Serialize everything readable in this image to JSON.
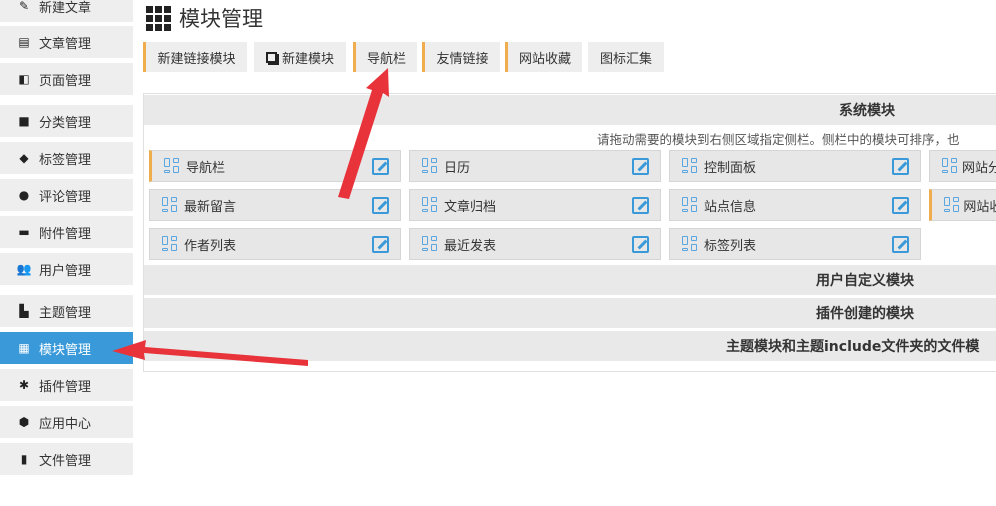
{
  "sidebar": {
    "items": [
      {
        "label": "新建文章",
        "icon": "edit-icon"
      },
      {
        "label": "文章管理",
        "icon": "document-icon"
      },
      {
        "label": "页面管理",
        "icon": "page-icon"
      },
      {
        "label": "分类管理",
        "icon": "folder-icon"
      },
      {
        "label": "标签管理",
        "icon": "tag-icon"
      },
      {
        "label": "评论管理",
        "icon": "comment-icon"
      },
      {
        "label": "附件管理",
        "icon": "inbox-icon"
      },
      {
        "label": "用户管理",
        "icon": "users-icon"
      },
      {
        "label": "主题管理",
        "icon": "layout-icon"
      },
      {
        "label": "模块管理",
        "icon": "grid-icon",
        "active": true
      },
      {
        "label": "插件管理",
        "icon": "puzzle-icon"
      },
      {
        "label": "应用中心",
        "icon": "cube-icon"
      },
      {
        "label": "文件管理",
        "icon": "file-icon"
      }
    ]
  },
  "page": {
    "title": "模块管理"
  },
  "toolbar": {
    "buttons": [
      {
        "label": "新建链接模块"
      },
      {
        "label": "新建模块"
      },
      {
        "label": "导航栏"
      },
      {
        "label": "友情链接"
      },
      {
        "label": "网站收藏"
      },
      {
        "label": "图标汇集"
      }
    ]
  },
  "panel": {
    "system_header": "系统模块",
    "hint": "请拖动需要的模块到右侧区域指定侧栏。侧栏中的模块可排序，也",
    "widgets": [
      {
        "label": "导航栏"
      },
      {
        "label": "日历"
      },
      {
        "label": "控制面板"
      },
      {
        "label": "网站分"
      },
      {
        "label": "最新留言"
      },
      {
        "label": "文章归档"
      },
      {
        "label": "站点信息"
      },
      {
        "label": "网站收"
      },
      {
        "label": "作者列表"
      },
      {
        "label": "最近发表"
      },
      {
        "label": "标签列表"
      }
    ],
    "user_header": "用户自定义模块",
    "plugin_header": "插件创建的模块",
    "theme_header": "主题模块和主题include文件夹的文件模"
  },
  "colors": {
    "accent": "#3a9ad9",
    "orange": "#f0ad4e",
    "arrow": "#e8333a"
  }
}
